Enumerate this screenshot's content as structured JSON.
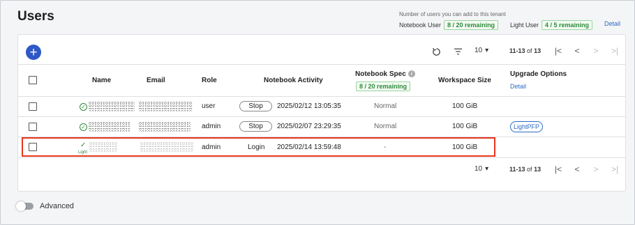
{
  "page": {
    "title": "Users"
  },
  "quota": {
    "header": "Number of users you can add to this tenant",
    "notebook_user_label": "Notebook User",
    "notebook_user_value": "8 / 20 remaining",
    "light_user_label": "Light User",
    "light_user_value": "4 / 5 remaining",
    "detail_link": "Detail"
  },
  "toolbar": {
    "add_icon": "+",
    "refresh_icon": "refresh-icon",
    "filter_icon": "filter-icon"
  },
  "pager": {
    "page_size": "10",
    "range": "11-13",
    "of_label": "of",
    "total": "13",
    "first_icon": "|<",
    "prev_icon": "<",
    "next_icon": ">",
    "last_icon": ">|"
  },
  "columns": {
    "name": "Name",
    "email": "Email",
    "role": "Role",
    "notebook_activity": "Notebook Activity",
    "notebook_spec": "Notebook Spec",
    "notebook_spec_badge": "8 / 20 remaining",
    "workspace_size": "Workspace Size",
    "upgrade_options": "Upgrade Options",
    "upgrade_detail": "Detail"
  },
  "rows": [
    {
      "role": "user",
      "action": "Stop",
      "activity": "2025/02/12 13:05:35",
      "spec": "Normal",
      "workspace": "100 GiB",
      "upgrade": ""
    },
    {
      "role": "admin",
      "action": "Stop",
      "activity": "2025/02/07 23:29:35",
      "spec": "Normal",
      "workspace": "100 GiB",
      "upgrade": "LightPFP"
    },
    {
      "role": "admin",
      "action": "Login",
      "activity": "2025/02/14 13:59:48",
      "spec": "-",
      "workspace": "100 GiB",
      "upgrade": "",
      "type_tag": "Light"
    }
  ],
  "footer": {
    "advanced_label": "Advanced"
  },
  "colors": {
    "accent": "#2f58c7",
    "green": "#2e8a3a",
    "highlight": "#e8341c",
    "link": "#2b6cc4"
  }
}
